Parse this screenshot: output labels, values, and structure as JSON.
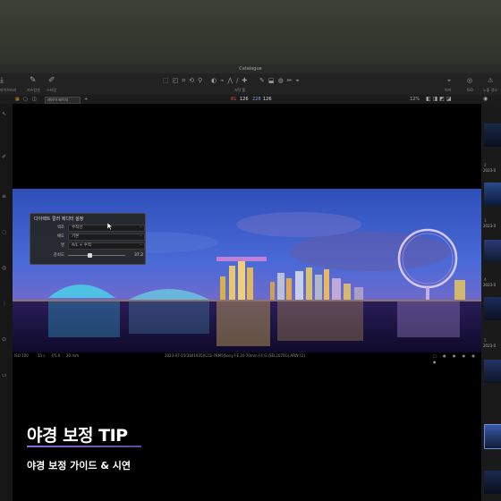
{
  "window": {
    "title": "Catalogue"
  },
  "toolbar": {
    "left_tools": [
      {
        "icon": "import-icon",
        "label": "라이브러리"
      },
      {
        "icon": "brush-icon",
        "label": "커스텀셋"
      },
      {
        "icon": "pen-icon",
        "label": "스타일"
      }
    ],
    "center_label": "저작 툴",
    "right_labels": [
      "피커",
      "ISO",
      "노출 경고"
    ]
  },
  "subbar": {
    "dropdown": "레이어 베이지",
    "add": "+",
    "rgb_values": [
      "81",
      "126",
      "228",
      "126"
    ],
    "zoom": "12%"
  },
  "panel": {
    "title": "다이렉트 컬러 에디터 설정",
    "rows": [
      {
        "label": "색조",
        "value": "수직선"
      },
      {
        "label": "채도",
        "value": "기본"
      },
      {
        "label": "명",
        "value": "A/L + 수직"
      }
    ],
    "slider": {
      "label": "감쇠도",
      "value": "37.2",
      "level": 0.37
    }
  },
  "statusbar": {
    "iso": "ISO 100",
    "shutter": "15 s",
    "aperture": "f/5.6",
    "focal": "20 mm",
    "file_info": "2023-07-15(3841935)ILCE-7RM5|Sony FE 20-70mm F4 G (SEL2070G).ARW [2]"
  },
  "filmstrip": {
    "dates": [
      "2023-0",
      "2023-0",
      "2023-0",
      "2023-0"
    ],
    "numbers": [
      "2",
      "3",
      "4",
      "5"
    ]
  },
  "caption": {
    "title": "야경 보정 TIP",
    "subtitle": "야경 보정 가이드 & 시연"
  }
}
